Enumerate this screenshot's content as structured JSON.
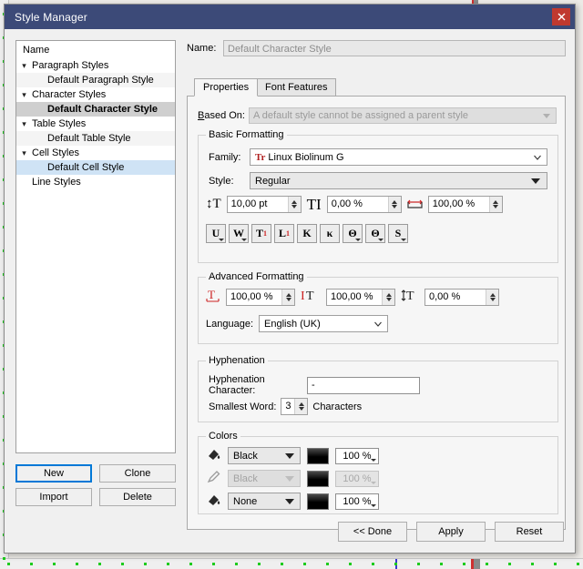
{
  "window": {
    "title": "Style Manager",
    "close_icon": "close-icon"
  },
  "tree": {
    "header": "Name",
    "items": [
      {
        "label": "Paragraph Styles",
        "level": 0,
        "expander": "chevron-down-icon",
        "state": "normal"
      },
      {
        "label": "Default Paragraph Style",
        "level": 1,
        "expander": "",
        "state": "alt"
      },
      {
        "label": "Character Styles",
        "level": 0,
        "expander": "chevron-down-icon",
        "state": "normal"
      },
      {
        "label": "Default Character Style",
        "level": 1,
        "expander": "",
        "state": "selected-gray"
      },
      {
        "label": "Table Styles",
        "level": 0,
        "expander": "chevron-down-icon",
        "state": "normal"
      },
      {
        "label": "Default Table Style",
        "level": 1,
        "expander": "",
        "state": "alt"
      },
      {
        "label": "Cell Styles",
        "level": 0,
        "expander": "chevron-down-icon",
        "state": "normal"
      },
      {
        "label": "Default Cell Style",
        "level": 1,
        "expander": "",
        "state": "selected-blue"
      },
      {
        "label": "Line Styles",
        "level": 0,
        "expander": "",
        "state": "normal"
      }
    ]
  },
  "left_buttons": {
    "new": "New",
    "clone": "Clone",
    "import": "Import",
    "delete": "Delete"
  },
  "name_row": {
    "label": "Name:",
    "value": "Default Character Style"
  },
  "tabs": [
    {
      "label": "Properties",
      "active": true
    },
    {
      "label": "Font Features",
      "active": false
    }
  ],
  "based_on": {
    "label": "Based On:",
    "value": "A default style cannot be assigned a parent style"
  },
  "basic_formatting": {
    "legend": "Basic Formatting",
    "family_label": "Family:",
    "family_value": "Linux Biolinum G",
    "family_type_icon": "Tr",
    "style_label": "Style:",
    "style_value": "Regular",
    "font_size": "10,00 pt",
    "tracking": "0,00 %",
    "width_scale": "100,00 %",
    "effect_buttons": [
      {
        "name": "underline-button",
        "glyph": "U",
        "mark": "",
        "dropdown": true
      },
      {
        "name": "underline-words-button",
        "glyph": "W",
        "mark": "",
        "dropdown": true
      },
      {
        "name": "subscript-button",
        "glyph": "T",
        "mark": "1",
        "markpos": "sub",
        "dropdown": false
      },
      {
        "name": "superscript-button",
        "glyph": "L",
        "mark": "1",
        "markpos": "sup",
        "dropdown": false
      },
      {
        "name": "all-caps-button",
        "glyph": "K",
        "mark": "",
        "dropdown": false
      },
      {
        "name": "small-caps-button",
        "glyph": "κ",
        "mark": "",
        "dropdown": false
      },
      {
        "name": "outline-button",
        "glyph": "Θ",
        "mark": "",
        "dropdown": true
      },
      {
        "name": "shadow-button",
        "glyph": "Θ",
        "mark": "",
        "dropdown": true
      },
      {
        "name": "strikethrough-button",
        "glyph": "S",
        "mark": "",
        "dropdown": true
      }
    ]
  },
  "advanced_formatting": {
    "legend": "Advanced Formatting",
    "scale_height": "100,00 %",
    "scale_width": "100,00 %",
    "baseline_offset": "0,00 %",
    "language_label": "Language:",
    "language_value": "English (UK)"
  },
  "hyphenation": {
    "legend": "Hyphenation",
    "char_label": "Hyphenation Character:",
    "char_value": "-",
    "smallest_label": "Smallest Word:",
    "smallest_value": "3",
    "characters_label": "Characters"
  },
  "colors": {
    "legend": "Colors",
    "rows": [
      {
        "icon": "fill-color-icon",
        "color": "Black",
        "shade": "100 %",
        "disabled": false
      },
      {
        "icon": "stroke-color-icon",
        "color": "Black",
        "shade": "100 %",
        "disabled": true
      },
      {
        "icon": "background-color-icon",
        "color": "None",
        "shade": "100 %",
        "disabled": false
      }
    ]
  },
  "bottom_buttons": {
    "done": "<< Done",
    "apply": "Apply",
    "reset": "Reset"
  },
  "theme": {
    "titlebar": "#3c4a78",
    "close": "#c0392f",
    "focus": "#0078d7",
    "selection_blue": "#cfe3f5",
    "selection_gray": "#cfcfcf"
  }
}
